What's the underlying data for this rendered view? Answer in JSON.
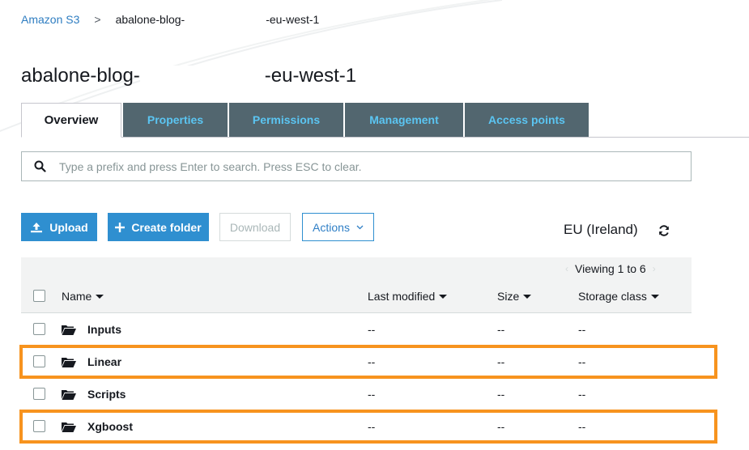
{
  "breadcrumb": {
    "root": "Amazon S3",
    "separator": ">",
    "bucket_prefix": "abalone-blog-",
    "bucket_suffix": "-eu-west-1"
  },
  "title": {
    "prefix": "abalone-blog-",
    "suffix": "-eu-west-1"
  },
  "tabs": [
    {
      "label": "Overview",
      "active": true
    },
    {
      "label": "Properties"
    },
    {
      "label": "Permissions"
    },
    {
      "label": "Management"
    },
    {
      "label": "Access points"
    }
  ],
  "search": {
    "placeholder": "Type a prefix and press Enter to search. Press ESC to clear.",
    "value": ""
  },
  "toolbar": {
    "upload": "Upload",
    "create_folder": "Create folder",
    "download": "Download",
    "actions": "Actions",
    "region": "EU (Ireland)"
  },
  "table": {
    "pager": "Viewing 1 to 6",
    "columns": {
      "name": "Name",
      "modified": "Last modified",
      "size": "Size",
      "storage": "Storage class"
    },
    "rows": [
      {
        "name": "Inputs",
        "modified": "--",
        "size": "--",
        "storage": "--",
        "highlighted": false
      },
      {
        "name": "Linear",
        "modified": "--",
        "size": "--",
        "storage": "--",
        "highlighted": true
      },
      {
        "name": "Scripts",
        "modified": "--",
        "size": "--",
        "storage": "--",
        "highlighted": false
      },
      {
        "name": "Xgboost",
        "modified": "--",
        "size": "--",
        "storage": "--",
        "highlighted": true
      }
    ]
  },
  "colors": {
    "tab_bg": "#52666f",
    "tab_text": "#5bc5f2",
    "primary": "#2f8fd0",
    "highlight": "#f7931e"
  }
}
